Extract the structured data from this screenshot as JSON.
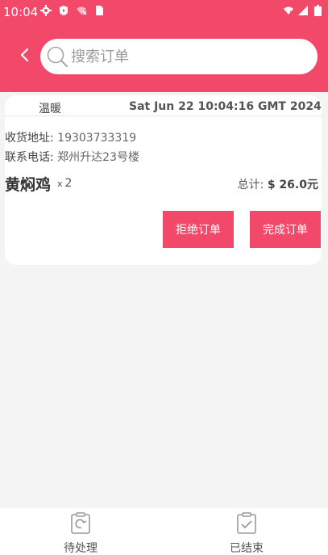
{
  "status_bar": {
    "time": "10:04"
  },
  "header": {
    "back_icon": "chevron-left-icon",
    "search": {
      "placeholder": "搜索订单",
      "value": ""
    }
  },
  "order": {
    "buyer": "温暖",
    "time": "Sat Jun 22 10:04:16 GMT 2024",
    "address_label": "收货地址:",
    "address_value": "19303733319",
    "phone_label": "联系电话:",
    "phone_value": "郑州升达23号楼",
    "dish_name": "黄焖鸡",
    "qty_x": "x",
    "quantity": "2",
    "total_label": "总计:",
    "total_value": "$ 26.0元",
    "reject_label": "拒绝订单",
    "complete_label": "完成订单"
  },
  "bottom_nav": {
    "items": [
      {
        "label": "待处理",
        "icon": "refresh-clipboard-icon"
      },
      {
        "label": "已结束",
        "icon": "check-clipboard-icon"
      }
    ]
  },
  "colors": {
    "accent": "#f2496a",
    "background": "#f4f4f4"
  }
}
